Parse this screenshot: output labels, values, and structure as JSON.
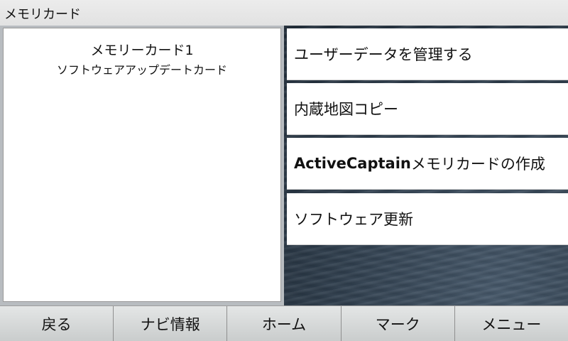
{
  "window": {
    "title": "メモリカード"
  },
  "info_panel": {
    "title": "メモリーカード1",
    "subtitle": "ソフトウェアアップデートカード"
  },
  "menu": {
    "items": [
      {
        "label": "ユーザーデータを管理する"
      },
      {
        "label": "内蔵地図コピー"
      },
      {
        "label_bold": "ActiveCaptain",
        "label": "メモリカードの作成"
      },
      {
        "label": "ソフトウェア更新"
      }
    ]
  },
  "softkeys": {
    "back": "戻る",
    "nav_info": "ナビ情報",
    "home": "ホーム",
    "mark": "マーク",
    "menu": "メニュー"
  },
  "colors": {
    "sea_dark": "#1f2b37",
    "sea_light": "#46586a",
    "panel_bg": "#ffffff",
    "softkey_bar": "#d6d8d8"
  }
}
